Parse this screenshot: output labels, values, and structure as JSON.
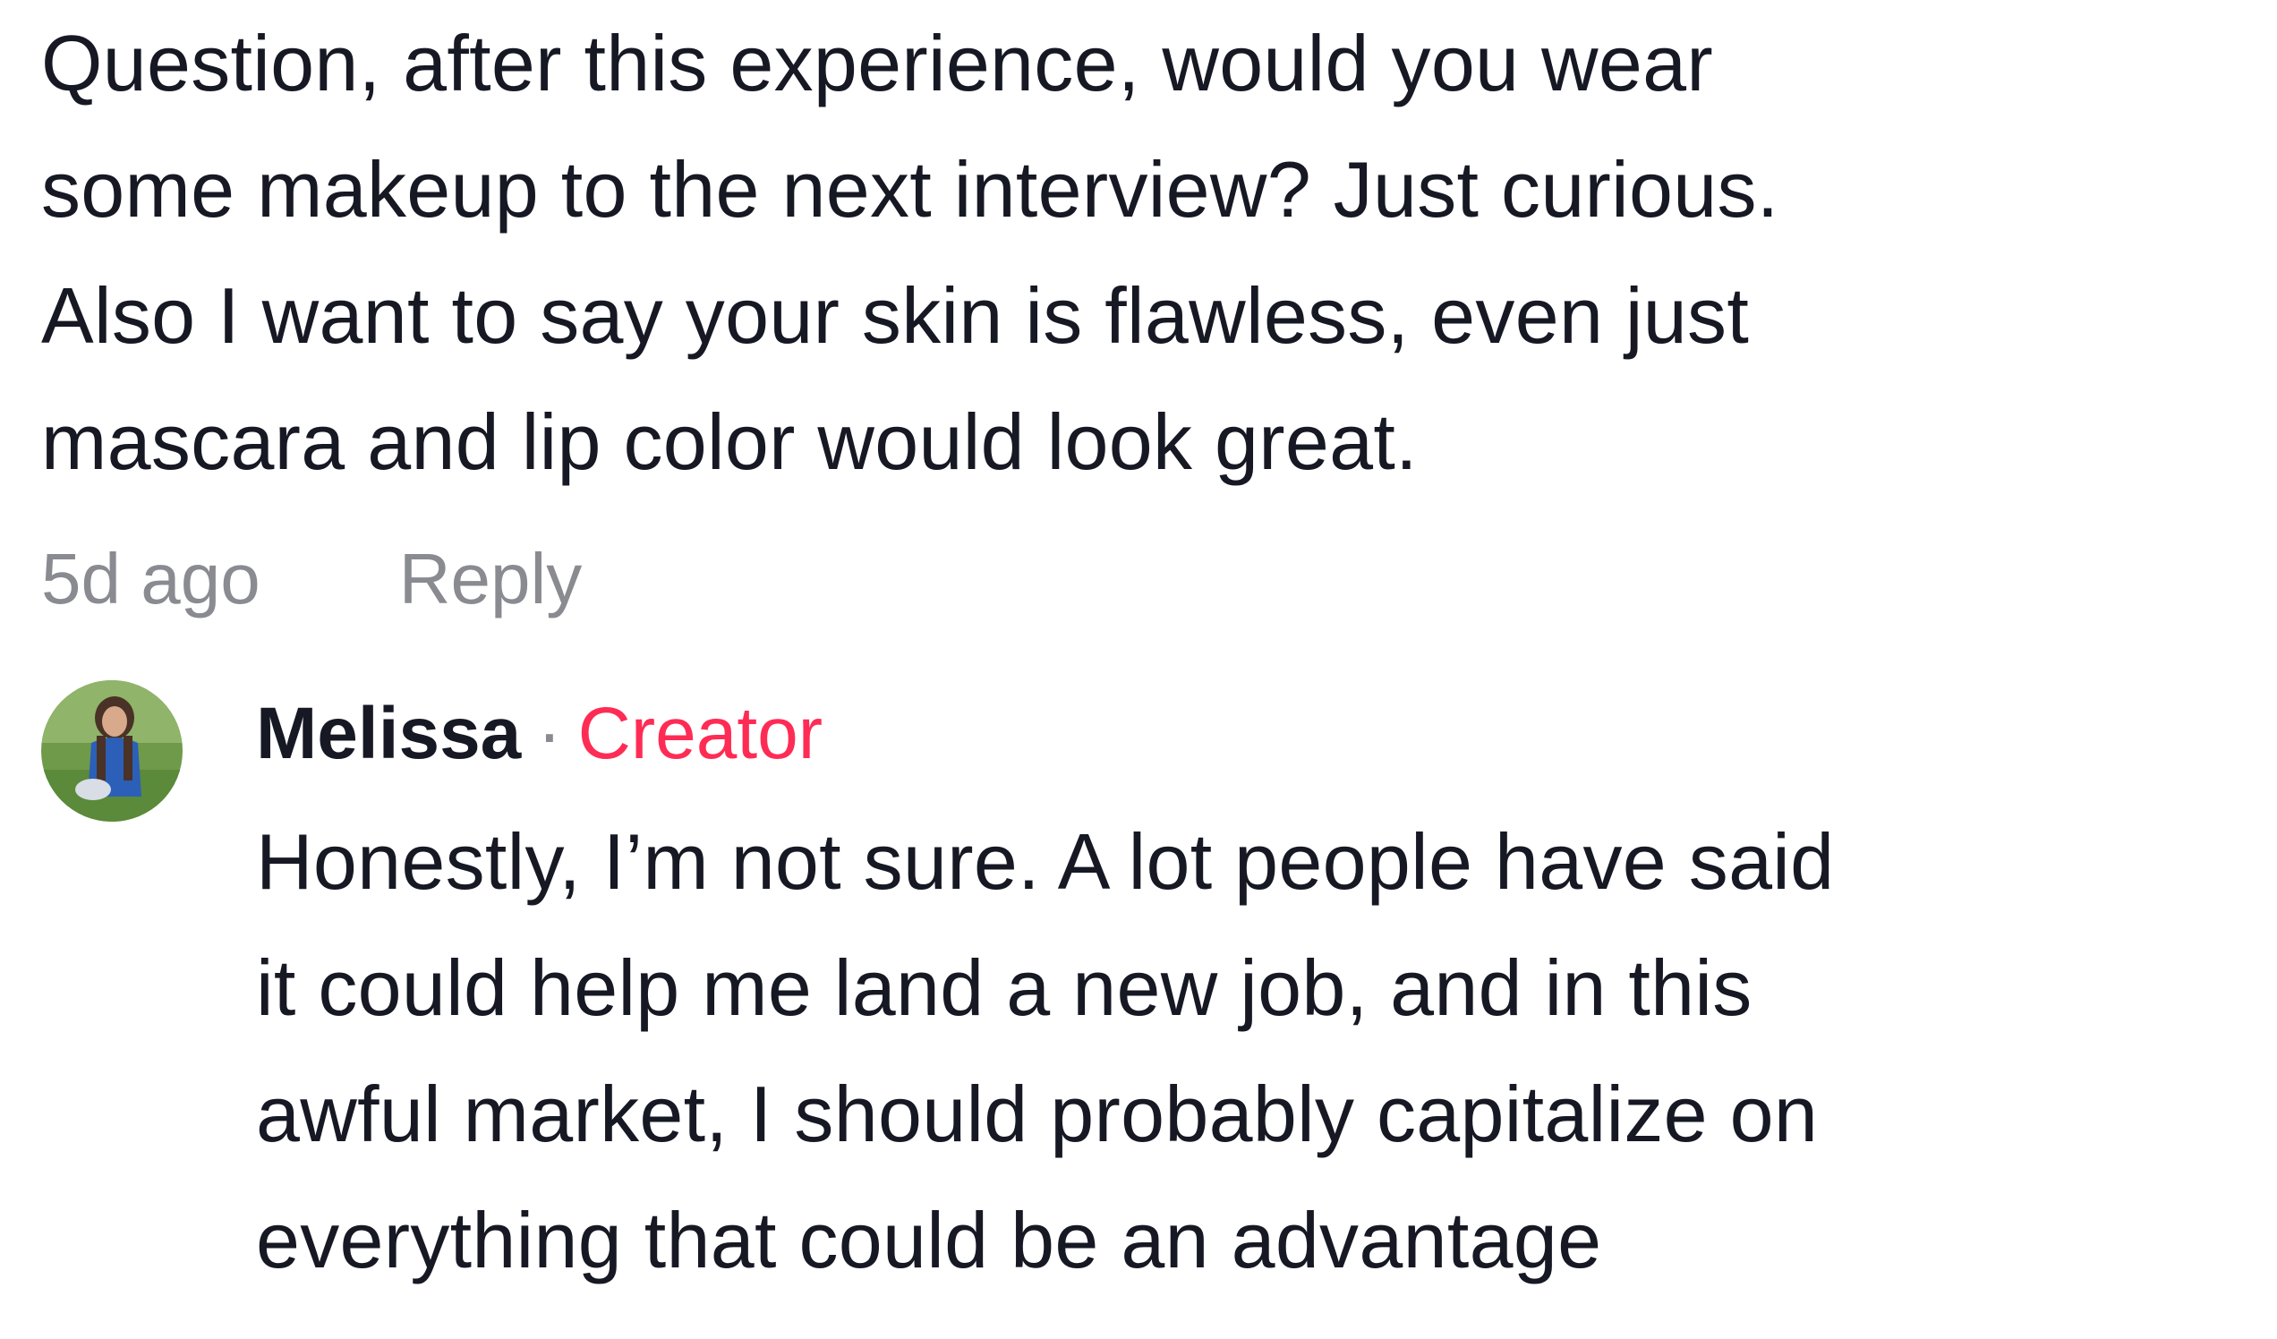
{
  "comment": {
    "text": "Question, after this experience, would you wear\nsome makeup to the next interview? Just curious.\nAlso I want to say your skin is flawless, even just\nmascara and lip color would look great.",
    "timestamp": "5d ago",
    "reply_label": "Reply"
  },
  "reply": {
    "author": "Melissa",
    "separator": "·",
    "badge": "Creator",
    "text": "Honestly, I’m not sure. A lot people have said\nit could help me land a new job, and in this\nawful market, I should probably capitalize on\neverything that could be an advantage"
  },
  "colors": {
    "text": "#161823",
    "muted": "#8a8b91",
    "creator_accent": "#fe2c55"
  }
}
